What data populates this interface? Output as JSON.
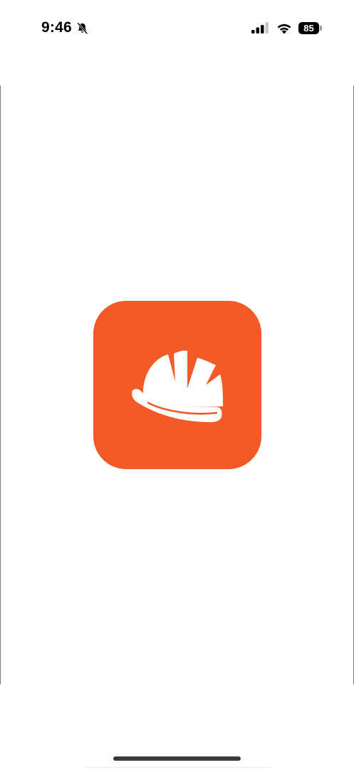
{
  "status_bar": {
    "time": "9:46",
    "battery_level": "85",
    "icons": [
      "bell-slash-icon",
      "cellular-signal-icon",
      "wifi-icon",
      "battery-icon"
    ]
  },
  "splash": {
    "icon": "hard-hat-icon",
    "background_color": "#f25a27",
    "foreground_color": "#ffffff"
  }
}
